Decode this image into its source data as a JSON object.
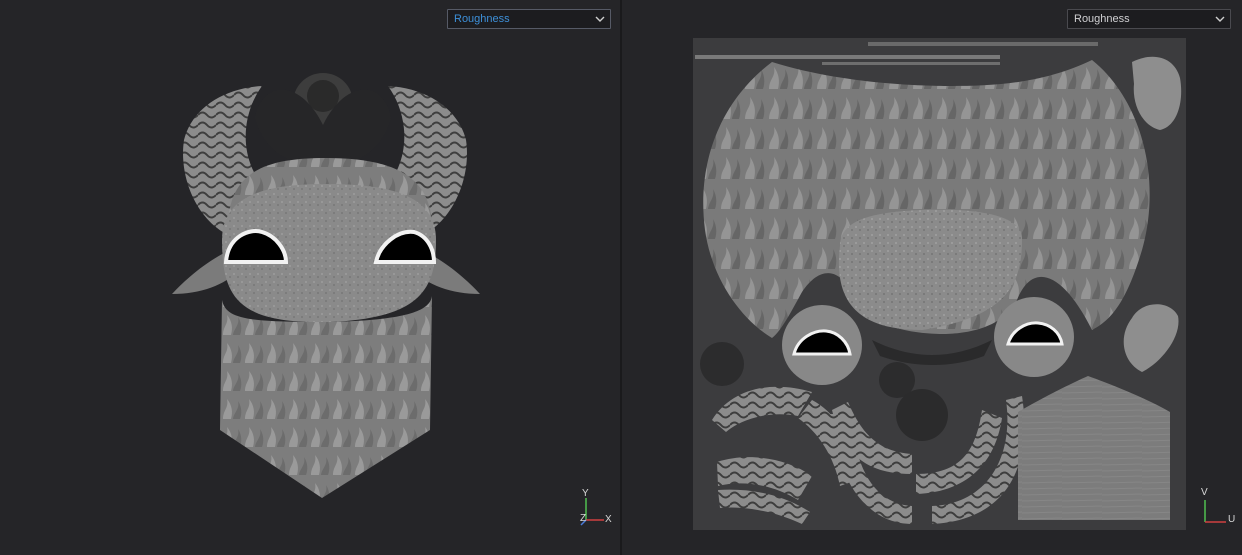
{
  "viewport_3d": {
    "channel_select": {
      "value": "Roughness"
    },
    "axis": {
      "y": "Y",
      "z": "Z",
      "x": "X"
    }
  },
  "viewport_uv": {
    "channel_select": {
      "value": "Roughness"
    },
    "axis": {
      "v": "V",
      "u": "U"
    }
  },
  "colors": {
    "background": "#252528",
    "select_active_text": "#3d8fd8",
    "axis_x": "#d04040",
    "axis_y": "#50c050",
    "axis_z": "#4a7ad8"
  }
}
